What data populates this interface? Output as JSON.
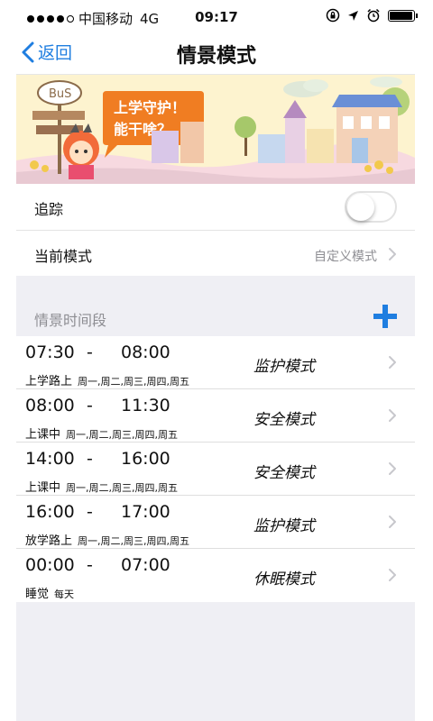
{
  "status_bar": {
    "carrier": "中国移动",
    "network": "4G",
    "time": "09:17",
    "signal_bars_filled": 4,
    "signal_bars_total": 5,
    "battery_level": 0.95,
    "icons": [
      "lock-rotation-icon",
      "location-arrow-icon",
      "alarm-icon",
      "battery-icon"
    ]
  },
  "nav": {
    "back_label": "返回",
    "title": "情景模式"
  },
  "banner": {
    "bubble_line1": "上学守护！",
    "bubble_line2": "能干啥？",
    "sign_text": "BuS"
  },
  "settings": {
    "tracking_label": "追踪",
    "tracking_on": false,
    "current_mode_label": "当前模式",
    "current_mode_value": "自定义模式"
  },
  "periods_section": {
    "title": "情景时间段",
    "dash": "-",
    "items": [
      {
        "start": "07:30",
        "end": "08:00",
        "name": "上学路上",
        "days": "周一,周二,周三,周四,周五",
        "mode": "监护模式"
      },
      {
        "start": "08:00",
        "end": "11:30",
        "name": "上课中",
        "days": "周一,周二,周三,周四,周五",
        "mode": "安全模式"
      },
      {
        "start": "14:00",
        "end": "16:00",
        "name": "上课中",
        "days": "周一,周二,周三,周四,周五",
        "mode": "安全模式"
      },
      {
        "start": "16:00",
        "end": "17:00",
        "name": "放学路上",
        "days": "周一,周二,周三,周四,周五",
        "mode": "监护模式"
      },
      {
        "start": "00:00",
        "end": "07:00",
        "name": "睡觉",
        "days": "每天",
        "mode": "休眠模式"
      }
    ]
  },
  "colors": {
    "accent": "#1f7ee0",
    "group_background": "#efeff4",
    "secondary_text": "#8e8e93",
    "bubble": "#f07d22"
  }
}
